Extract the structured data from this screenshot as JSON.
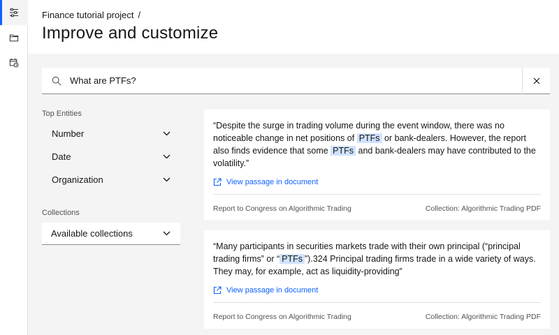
{
  "breadcrumb": {
    "project": "Finance tutorial project",
    "separator": "/"
  },
  "page_title": "Improve and customize",
  "search": {
    "value": "What are PTFs?"
  },
  "top_entities": {
    "heading": "Top Entities",
    "items": [
      {
        "label": "Number"
      },
      {
        "label": "Date"
      },
      {
        "label": "Organization"
      }
    ]
  },
  "collections": {
    "heading": "Collections",
    "selected": "Available collections"
  },
  "results": [
    {
      "q1": "“Despite the surge in trading volume during the event window, there was no noticeable change in net positions of ",
      "tag1": "PTFs",
      "q2": " or bank-dealers. However, the report also finds evidence that some ",
      "tag2": "PTFs",
      "q3": " and bank-dealers may have contributed to the volatility.”",
      "link": "View passage in document",
      "document": "Report to Congress on Algorithmic Trading",
      "collection": "Collection: Algorithmic Trading PDF"
    },
    {
      "q1": "“Many participants in securities markets trade with their own principal (“principal trading firms” or “",
      "tag1": "PTFs",
      "q2": "”).324 Principal trading firms trade in a wide variety of ways. They may, for example, act as liquidity-providing”",
      "link": "View passage in document",
      "document": "Report to Congress on Algorithmic Trading",
      "collection": "Collection: Algorithmic Trading PDF"
    }
  ],
  "colors": {
    "accent": "#0f62fe",
    "tag_bg": "#d0e2ff",
    "page_bg": "#f4f4f4"
  }
}
